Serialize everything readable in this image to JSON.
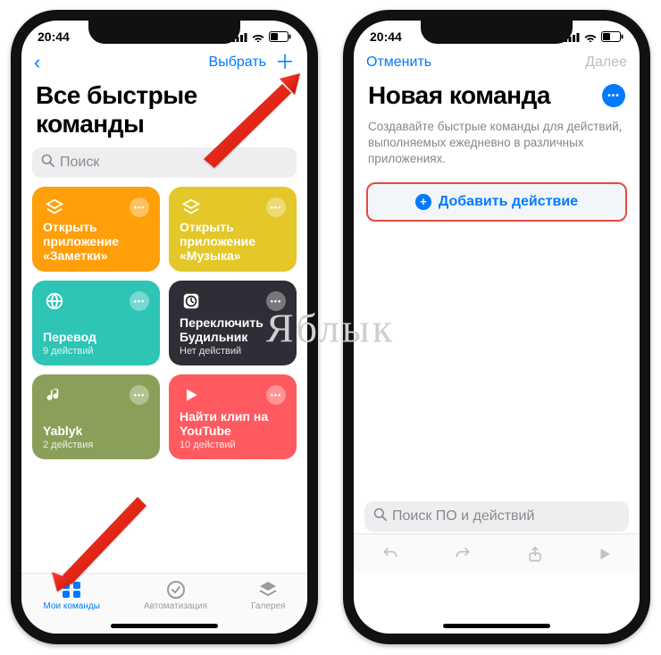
{
  "status": {
    "time": "20:44"
  },
  "left": {
    "nav": {
      "select": "Выбрать"
    },
    "title": "Все быстрые команды",
    "search_placeholder": "Поиск",
    "cards": [
      {
        "title": "Открыть приложение «Заметки»",
        "sub": ""
      },
      {
        "title": "Открыть приложение «Музыка»",
        "sub": ""
      },
      {
        "title": "Перевод",
        "sub": "9 действий"
      },
      {
        "title": "Переключить Будильник",
        "sub": "Нет действий"
      },
      {
        "title": "Yablyk",
        "sub": "2 действия"
      },
      {
        "title": "Найти клип на YouTube",
        "sub": "10 действий"
      }
    ],
    "tabs": {
      "my": "Мои команды",
      "auto": "Автоматизация",
      "gallery": "Галерея"
    }
  },
  "right": {
    "nav": {
      "cancel": "Отменить",
      "next": "Далее"
    },
    "title": "Новая команда",
    "desc": "Создавайте быстрые команды для действий, выполняемых ежедневно в различных приложениях.",
    "add_action": "Добавить действие",
    "search_placeholder": "Поиск ПО и действий"
  },
  "watermark": "Яблык"
}
